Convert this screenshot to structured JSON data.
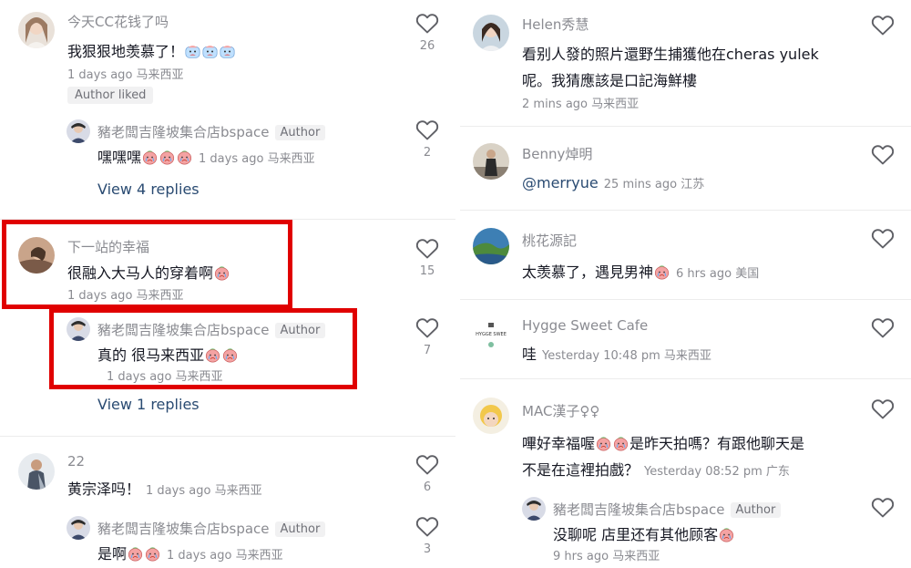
{
  "left": {
    "c1": {
      "user": "今天CC花钱了吗",
      "text": "我狠狠地羡慕了！",
      "time": "1 days ago",
      "loc": "马来西亚",
      "badge": "Author liked",
      "likes": "26"
    },
    "r1": {
      "user": "豬老闆吉隆坡集合店bspace",
      "tag": "Author",
      "text": "嘿嘿嘿",
      "time": "1 days ago",
      "loc": "马来西亚",
      "likes": "2"
    },
    "view1": "View 4 replies",
    "c2": {
      "user": "下一站的幸福",
      "text": "很融入大马人的穿着啊",
      "time": "1 days ago",
      "loc": "马来西亚",
      "likes": "15"
    },
    "r2": {
      "user": "豬老闆吉隆坡集合店bspace",
      "tag": "Author",
      "text": "真的 很马来西亚",
      "time": "1 days ago",
      "loc": "马来西亚",
      "likes": "7"
    },
    "view2": "View 1 replies",
    "c3": {
      "user": "22",
      "text": "黄宗泽吗！",
      "time": "1 days ago",
      "loc": "马来西亚",
      "likes": "6"
    },
    "r3": {
      "user": "豬老闆吉隆坡集合店bspace",
      "tag": "Author",
      "text": "是啊",
      "time": "1 days ago",
      "loc": "马来西亚",
      "likes": "3"
    }
  },
  "right": {
    "c1": {
      "user": "Helen秀慧",
      "line1": "看别人發的照片還野生捕獲他在cheras yulek",
      "line2": "呢。我猜應該是口記海鮮樓",
      "time": "2 mins ago",
      "loc": "马来西亚"
    },
    "c2": {
      "user": "Benny焯明",
      "mention": "@merryue",
      "time": "25 mins ago",
      "loc": "江苏"
    },
    "c3": {
      "user": "桃花源記",
      "text": "太羡慕了，遇見男神",
      "time": "6 hrs ago",
      "loc": "美国"
    },
    "c4": {
      "user": "Hygge Sweet Cafe",
      "text": "哇",
      "time": "Yesterday 10:48 pm",
      "loc": "马来西亚",
      "avatar_text": "HYGGE SWEE"
    },
    "c5": {
      "user": "MAC漢子♀♀",
      "line1": "嗶好幸福喔",
      "line1b": "是昨天拍嗎？有跟他聊天是",
      "line2": "不是在這裡拍戲？",
      "time": "Yesterday 08:52 pm",
      "loc": "广东"
    },
    "r5": {
      "user": "豬老闆吉隆坡集合店bspace",
      "tag": "Author",
      "text": "没聊呢 店里还有其他顾客",
      "time": "9 hrs ago",
      "loc": "马来西亚"
    }
  },
  "icons": {
    "like": "heart-outline-icon",
    "emoji": "crying-peach-emoji"
  },
  "colors": {
    "highlight": "#e00000",
    "link": "#2a4b72",
    "muted": "#8a8b91"
  }
}
